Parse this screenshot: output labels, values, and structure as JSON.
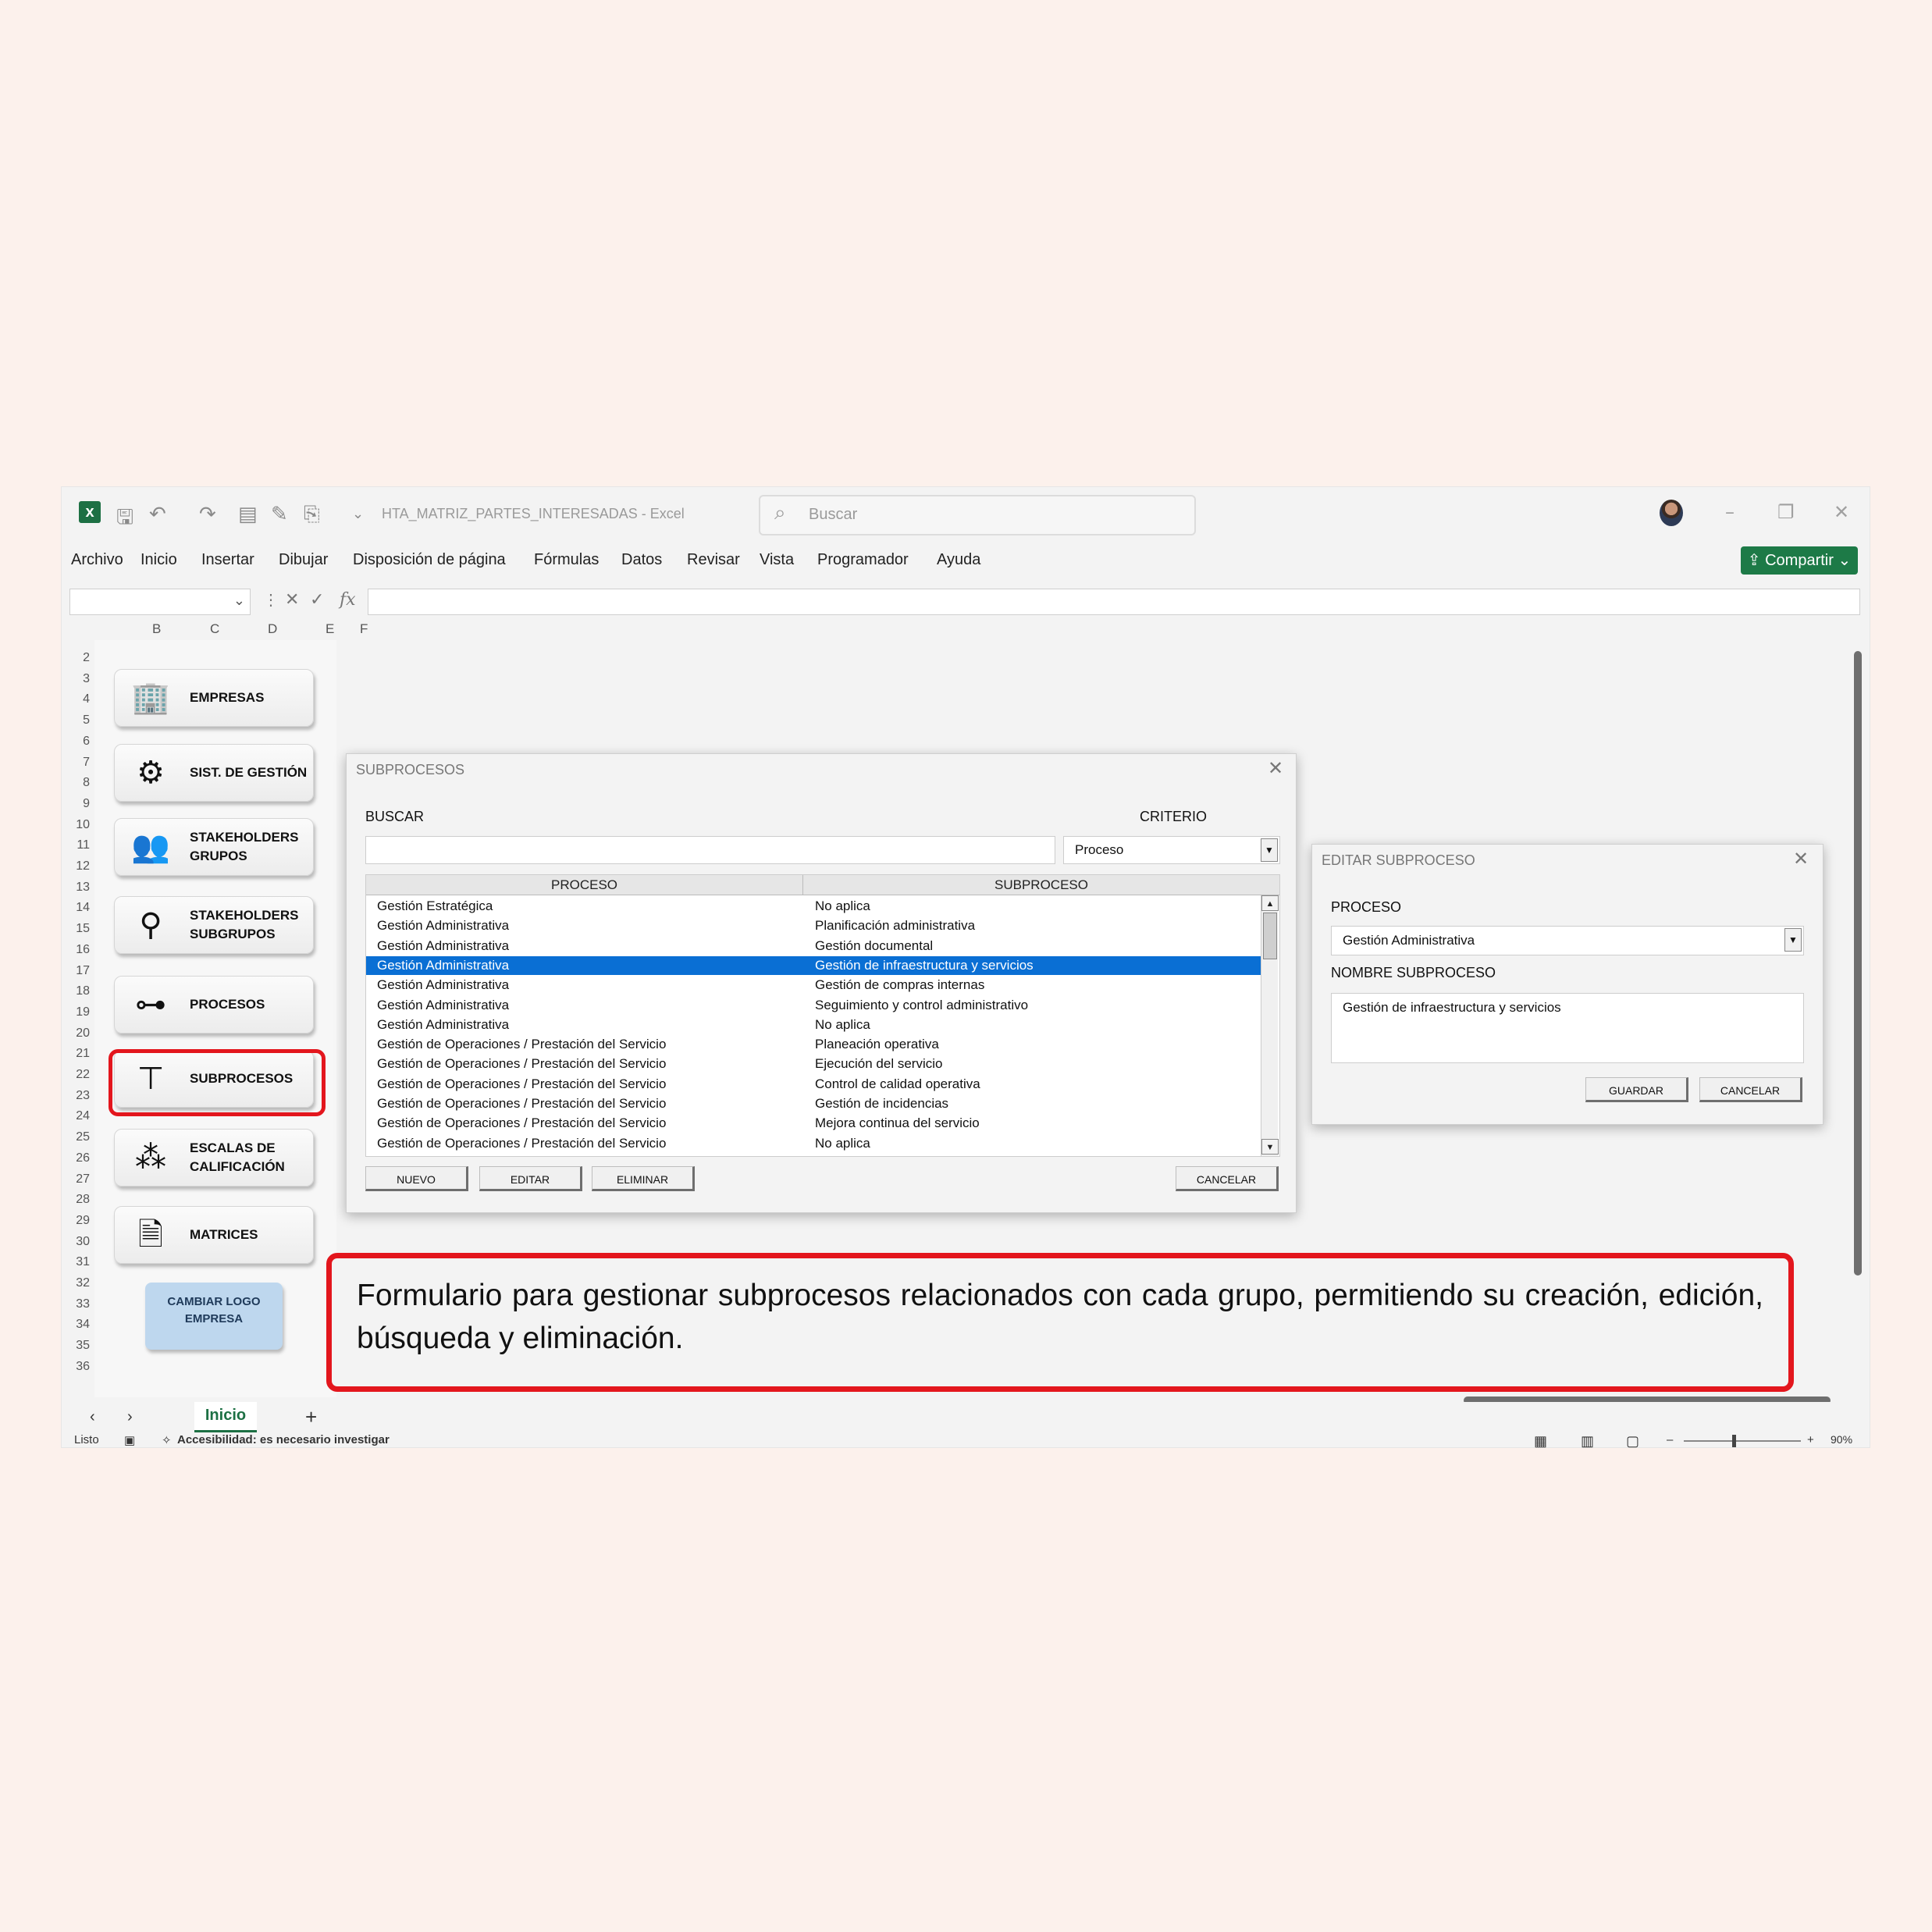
{
  "window": {
    "document_title": "HTA_MATRIZ_PARTES_INTERESADAS",
    "app_name": "Excel",
    "search_placeholder": "Buscar",
    "share_label": "Compartir"
  },
  "menu": [
    "Archivo",
    "Inicio",
    "Insertar",
    "Dibujar",
    "Disposición de página",
    "Fórmulas",
    "Datos",
    "Revisar",
    "Vista",
    "Programador",
    "Ayuda"
  ],
  "formula_bar": {
    "fx_label": "fx"
  },
  "grid": {
    "columns": [
      "B",
      "C",
      "D",
      "E",
      "F"
    ],
    "rows": [
      "2",
      "3",
      "4",
      "5",
      "6",
      "7",
      "8",
      "9",
      "10",
      "11",
      "12",
      "13",
      "14",
      "15",
      "16",
      "17",
      "18",
      "19",
      "20",
      "21",
      "22",
      "23",
      "24",
      "25",
      "26",
      "27",
      "28",
      "29",
      "30",
      "31",
      "32",
      "33",
      "34",
      "35",
      "36"
    ]
  },
  "nav": {
    "items": [
      {
        "label": "EMPRESAS",
        "icon": "building-icon"
      },
      {
        "label": "SIST. DE GESTIÓN",
        "icon": "gears-icon"
      },
      {
        "label": "STAKEHOLDERS\nGRUPOS",
        "icon": "people-group-icon"
      },
      {
        "label": "STAKEHOLDERS\nSUBGRUPOS",
        "icon": "org-people-icon"
      },
      {
        "label": "PROCESOS",
        "icon": "process-flow-icon"
      },
      {
        "label": "SUBPROCESOS",
        "icon": "hierarchy-icon"
      },
      {
        "label": "ESCALAS DE\nCALIFICACIÓN",
        "icon": "stars-icon"
      },
      {
        "label": "MATRICES",
        "icon": "matrix-document-icon"
      }
    ],
    "logo_button": "CAMBIAR LOGO\nEMPRESA"
  },
  "sheet_tab": "Inicio",
  "status": {
    "ready": "Listo",
    "accessibility": "Accesibilidad: es necesario investigar",
    "zoom": "90%"
  },
  "subprocesos_dialog": {
    "title": "SUBPROCESOS",
    "search_label": "BUSCAR",
    "search_value": "",
    "criterio_label": "CRITERIO",
    "criterio_value": "Proceso",
    "columns": [
      "PROCESO",
      "SUBPROCESO"
    ],
    "rows": [
      [
        "Gestión Estratégica",
        "No aplica"
      ],
      [
        "Gestión Administrativa",
        "Planificación administrativa"
      ],
      [
        "Gestión Administrativa",
        "Gestión documental"
      ],
      [
        "Gestión Administrativa",
        "Gestión de infraestructura y servicios"
      ],
      [
        "Gestión Administrativa",
        "Gestión de compras internas"
      ],
      [
        "Gestión Administrativa",
        "Seguimiento y control administrativo"
      ],
      [
        "Gestión Administrativa",
        "No aplica"
      ],
      [
        "Gestión de Operaciones / Prestación del Servicio",
        "Planeación operativa"
      ],
      [
        "Gestión de Operaciones / Prestación del Servicio",
        "Ejecución del servicio"
      ],
      [
        "Gestión de Operaciones / Prestación del Servicio",
        "Control de calidad operativa"
      ],
      [
        "Gestión de Operaciones / Prestación del Servicio",
        "Gestión de incidencias"
      ],
      [
        "Gestión de Operaciones / Prestación del Servicio",
        "Mejora continua del servicio"
      ],
      [
        "Gestión de Operaciones / Prestación del Servicio",
        "No aplica"
      ]
    ],
    "selected_row": 3,
    "buttons": {
      "new": "NUEVO",
      "edit": "EDITAR",
      "delete": "ELIMINAR",
      "cancel": "CANCELAR"
    }
  },
  "edit_dialog": {
    "title": "EDITAR SUBPROCESO",
    "proceso_label": "PROCESO",
    "proceso_value": "Gestión Administrativa",
    "nombre_label": "NOMBRE SUBPROCESO",
    "nombre_value": "Gestión de infraestructura y servicios",
    "buttons": {
      "save": "GUARDAR",
      "cancel": "CANCELAR"
    }
  },
  "caption": "Formulario para gestionar subprocesos relacionados con cada grupo, permitiendo su creación, edición, búsqueda y eliminación.",
  "colors": {
    "excel_green": "#1d7044",
    "highlight_red": "#e3161d",
    "selection_blue": "#0a6fd4",
    "background": "#fcf1ec"
  }
}
